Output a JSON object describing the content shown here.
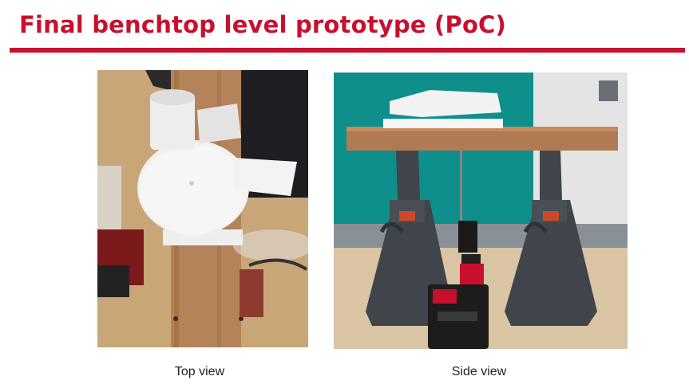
{
  "slide": {
    "title": "Final benchtop level prototype (PoC)",
    "accent_color": "#c8102e"
  },
  "figures": [
    {
      "caption": "Top view"
    },
    {
      "caption": "Side view"
    }
  ]
}
